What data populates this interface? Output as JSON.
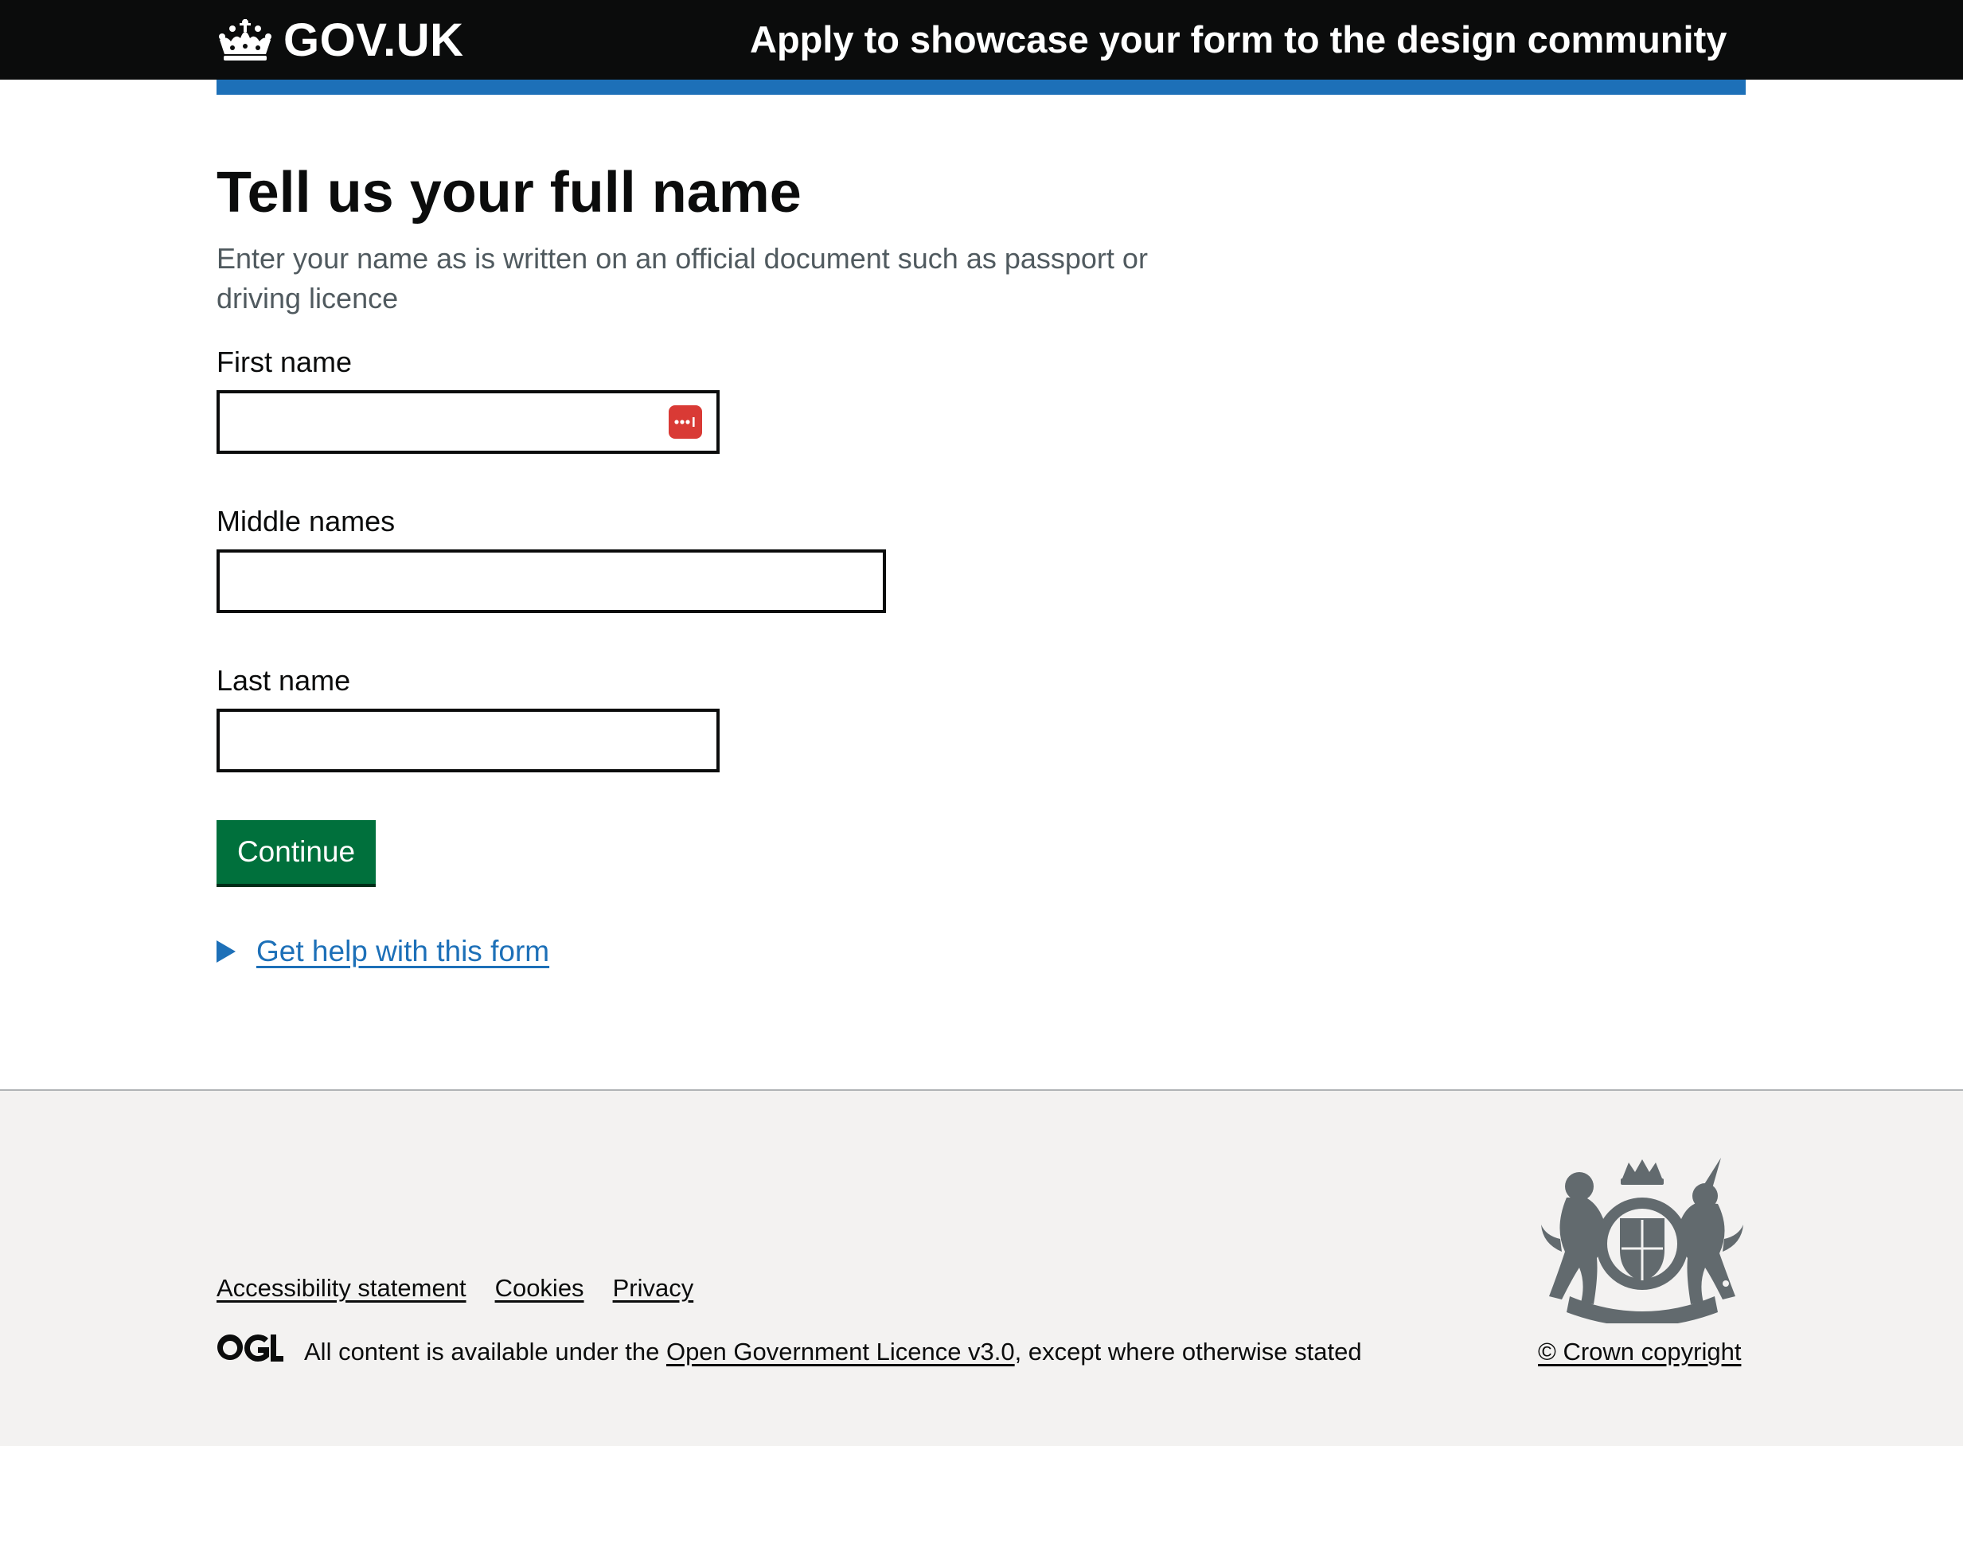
{
  "header": {
    "logo_text": "GOV.UK",
    "service_name": "Apply to showcase your form to the design community",
    "logo_icon": "crown-icon"
  },
  "main": {
    "title": "Tell us your full name",
    "hint": "Enter your name as is written on an official document such as passport or driving licence",
    "fields": {
      "first_name": {
        "label": "First name",
        "value": ""
      },
      "middle_names": {
        "label": "Middle names",
        "value": ""
      },
      "last_name": {
        "label": "Last name",
        "value": ""
      }
    },
    "password_manager_icon": "password-manager-icon",
    "continue_label": "Continue",
    "help_label": "Get help with this form"
  },
  "footer": {
    "links": {
      "accessibility": "Accessibility statement",
      "cookies": "Cookies",
      "privacy": "Privacy"
    },
    "ogl_logo": "OGL",
    "licence_prefix": "All content is available under the ",
    "licence_link": "Open Government Licence v3.0",
    "licence_suffix": ", except where otherwise stated",
    "crest_icon": "royal-coat-of-arms",
    "copyright": "© Crown copyright"
  },
  "colors": {
    "header_bg": "#0b0c0c",
    "brand_blue": "#1d70b8",
    "button_green": "#00703c",
    "footer_bg": "#f3f2f1",
    "hint_text": "#505a5f",
    "password_manager_red": "#d93a35"
  }
}
